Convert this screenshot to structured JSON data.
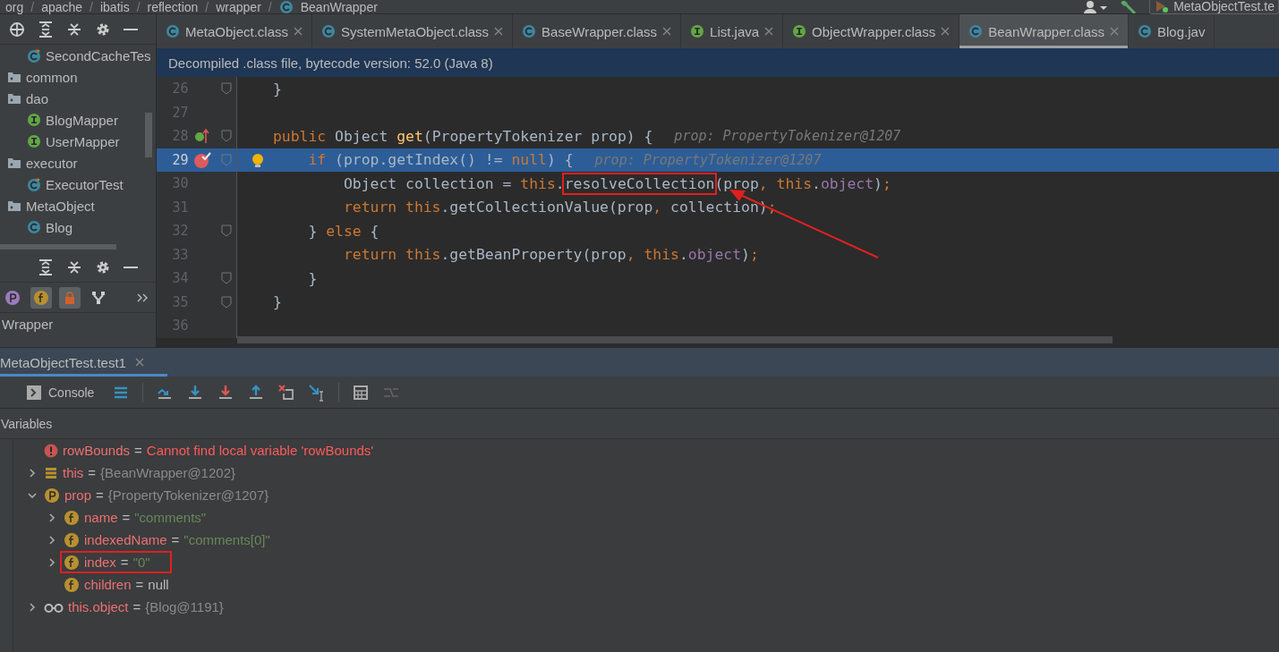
{
  "breadcrumb": [
    {
      "label": "org"
    },
    {
      "separator": "/",
      "label": "apache"
    },
    {
      "separator": "/",
      "label": "ibatis"
    },
    {
      "separator": "/",
      "label": "reflection"
    },
    {
      "separator": "/",
      "label": "wrapper"
    },
    {
      "separator": "/",
      "label": "BeanWrapper"
    }
  ],
  "run_config": "MetaObjectTest.te",
  "project_tree": [
    {
      "children": [
        {
          "kind": "test-class",
          "label": "SecondCacheTes"
        }
      ]
    },
    {
      "kind": "package",
      "label": "common"
    },
    {
      "kind": "package",
      "label": "dao",
      "children": [
        {
          "kind": "interface",
          "label": "BlogMapper"
        },
        {
          "kind": "interface",
          "label": "UserMapper"
        }
      ]
    },
    {
      "kind": "package",
      "label": "executor",
      "children": [
        {
          "kind": "test-class",
          "label": "ExecutorTest"
        }
      ]
    },
    {
      "kind": "package",
      "label": "MetaObject",
      "children": [
        {
          "kind": "class",
          "label": "Blog"
        }
      ]
    }
  ],
  "structure": {
    "filters": [
      {
        "kind": "property",
        "on": false
      },
      {
        "kind": "field",
        "on": true
      },
      {
        "kind": "lock",
        "on": true
      },
      {
        "kind": "hierarchy",
        "on": false
      }
    ],
    "items": [
      {
        "label": "Wrapper"
      }
    ]
  },
  "editor_tabs": [
    {
      "label": "MetaObject.class",
      "kind": "class",
      "selected": false,
      "closable": true
    },
    {
      "label": "SystemMetaObject.class",
      "kind": "class",
      "selected": false,
      "closable": true
    },
    {
      "label": "BaseWrapper.class",
      "kind": "class",
      "selected": false,
      "closable": true
    },
    {
      "label": "List.java",
      "kind": "interface",
      "selected": false,
      "closable": true
    },
    {
      "label": "ObjectWrapper.class",
      "kind": "interface",
      "selected": false,
      "closable": true
    },
    {
      "label": "BeanWrapper.class",
      "kind": "class",
      "selected": true,
      "closable": true
    },
    {
      "label": "Blog.jav",
      "kind": "class",
      "selected": false,
      "closable": false
    }
  ],
  "banner": "Decompiled .class file, bytecode version: 52.0 (Java 8)",
  "code_lines": [
    {
      "number": "26",
      "current": false,
      "kind": "plain",
      "fold": true,
      "intention": false,
      "tokens": [
        {
          "text": "}",
          "kind": "plain"
        }
      ]
    },
    {
      "number": "27",
      "current": false,
      "kind": "plain"
    },
    {
      "number": "28",
      "current": false,
      "kind": "implements",
      "fold": true,
      "intention": false,
      "tokens": [
        {
          "text": "public",
          "kind": "keyword"
        },
        {
          "text": " Object ",
          "kind": "plain"
        },
        {
          "text": "get",
          "kind": "method"
        },
        {
          "text": "(PropertyTokenizer prop) {",
          "kind": "plain"
        }
      ],
      "hint": "prop: PropertyTokenizer@1207"
    },
    {
      "number": "29",
      "current": true,
      "kind": "breakpoint",
      "fold": true,
      "intention": true,
      "tokens": [
        {
          "text": "    if",
          "kind": "keyword"
        },
        {
          "text": " (prop.getIndex() != ",
          "kind": "plain"
        },
        {
          "text": "null",
          "kind": "keyword"
        },
        {
          "text": ") {",
          "kind": "plain"
        }
      ],
      "hint": "prop: PropertyTokenizer@1207"
    },
    {
      "number": "30",
      "current": false,
      "kind": "plain",
      "fold": false,
      "intention": false,
      "tokens": [
        {
          "text": "        Object collection = ",
          "kind": "plain"
        },
        {
          "text": "this",
          "kind": "keyword"
        },
        {
          "text": ".",
          "kind": "plain"
        },
        {
          "text": "resolveCollection",
          "kind": "plain",
          "annotated": true
        },
        {
          "text": "(prop",
          "kind": "plain"
        },
        {
          "text": ", ",
          "kind": "keyword"
        },
        {
          "text": "this",
          "kind": "keyword"
        },
        {
          "text": ".",
          "kind": "plain"
        },
        {
          "text": "object",
          "kind": "field"
        },
        {
          "text": ")",
          "kind": "plain"
        },
        {
          "text": ";",
          "kind": "keyword"
        }
      ]
    },
    {
      "number": "31",
      "current": false,
      "kind": "plain",
      "fold": false,
      "intention": false,
      "tokens": [
        {
          "text": "        return this",
          "kind": "keyword"
        },
        {
          "text": ".getCollectionValue(prop",
          "kind": "plain"
        },
        {
          "text": ", ",
          "kind": "keyword"
        },
        {
          "text": "collection)",
          "kind": "plain"
        },
        {
          "text": ";",
          "kind": "keyword"
        }
      ]
    },
    {
      "number": "32",
      "current": false,
      "kind": "plain",
      "fold": true,
      "intention": false,
      "tokens": [
        {
          "text": "    } ",
          "kind": "plain"
        },
        {
          "text": "else",
          "kind": "keyword"
        },
        {
          "text": " {",
          "kind": "plain"
        }
      ]
    },
    {
      "number": "33",
      "current": false,
      "kind": "plain",
      "fold": false,
      "intention": false,
      "tokens": [
        {
          "text": "        return this",
          "kind": "keyword"
        },
        {
          "text": ".getBeanProperty(prop",
          "kind": "plain"
        },
        {
          "text": ", this",
          "kind": "keyword"
        },
        {
          "text": ".",
          "kind": "plain"
        },
        {
          "text": "object",
          "kind": "field"
        },
        {
          "text": ")",
          "kind": "plain"
        },
        {
          "text": ";",
          "kind": "keyword"
        }
      ]
    },
    {
      "number": "34",
      "current": false,
      "kind": "plain",
      "fold": true,
      "intention": false,
      "tokens": [
        {
          "text": "    }",
          "kind": "plain"
        }
      ]
    },
    {
      "number": "35",
      "current": false,
      "kind": "plain",
      "fold": true,
      "intention": false,
      "tokens": [
        {
          "text": "}",
          "kind": "plain"
        }
      ]
    },
    {
      "number": "36",
      "current": false,
      "kind": "plain"
    }
  ],
  "debug": {
    "session_tab": {
      "label": "MetaObjectTest.test1",
      "selected": true
    },
    "console_tab": {
      "label": "Console",
      "selected": false
    },
    "variables_title": "Variables"
  },
  "variables": [
    {
      "kind": "error",
      "name": "rowBounds",
      "eq": "=",
      "value": {
        "text": "Cannot find local variable 'rowBounds'",
        "kind": "error"
      },
      "annotated": false
    },
    {
      "kind": "list",
      "name": "this",
      "eq": "=",
      "value": {
        "text": "{BeanWrapper@1202}",
        "kind": "object"
      },
      "expanded": false,
      "annotated": false
    },
    {
      "kind": "parameter",
      "name": "prop",
      "eq": "=",
      "value": {
        "text": "{PropertyTokenizer@1207}",
        "kind": "object"
      },
      "expanded": true,
      "annotated": false,
      "children": [
        {
          "kind": "field",
          "name": "name",
          "eq": "=",
          "value": {
            "text": "\"comments\"",
            "kind": "string"
          },
          "expanded": false,
          "annotated": false
        },
        {
          "kind": "field",
          "name": "indexedName",
          "eq": "=",
          "value": {
            "text": "\"comments[0]\"",
            "kind": "string"
          },
          "expanded": false,
          "annotated": false
        },
        {
          "kind": "field",
          "name": "index",
          "eq": "=",
          "value": {
            "text": "\"0\"",
            "kind": "string"
          },
          "expanded": false,
          "annotated": true
        },
        {
          "kind": "field",
          "name": "children",
          "eq": "=",
          "value": {
            "text": "null",
            "kind": "null"
          },
          "annotated": false
        }
      ]
    },
    {
      "kind": "watch",
      "name": "this.object",
      "eq": "=",
      "value": {
        "text": "{Blog@1191}",
        "kind": "object"
      },
      "expanded": false,
      "annotated": false
    }
  ]
}
